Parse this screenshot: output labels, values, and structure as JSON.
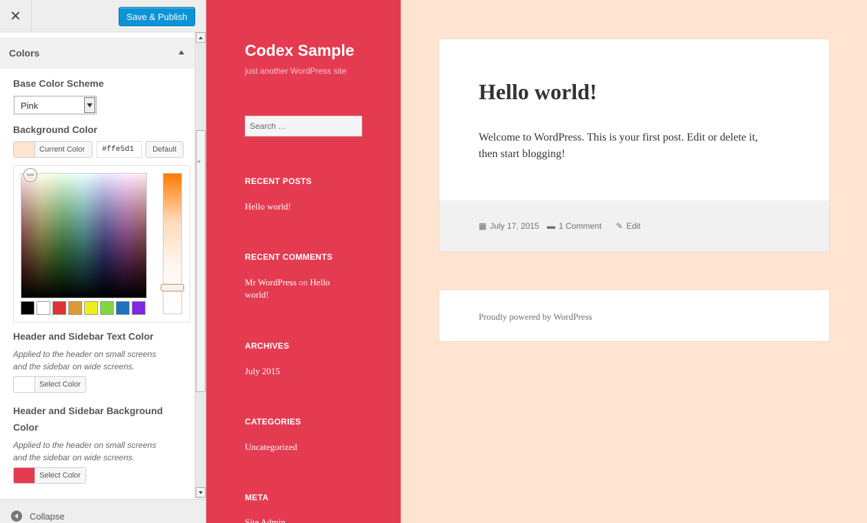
{
  "customizer": {
    "close_label": "✕",
    "publish_label": "Save & Publish",
    "section_title": "Colors",
    "base_scheme": {
      "label": "Base Color Scheme",
      "value": "Pink"
    },
    "background_color": {
      "label": "Background Color",
      "current_label": "Current Color",
      "swatch_color": "#ffe5d1",
      "hex_value": "#ffe5d1",
      "default_label": "Default"
    },
    "palette": [
      "#000000",
      "#ffffff",
      "#dd3333",
      "#dd9933",
      "#eeee22",
      "#81d742",
      "#1e73be",
      "#8224e3"
    ],
    "header_text_color": {
      "label": "Header and Sidebar Text Color",
      "desc_line1": "Applied to the header on small screens",
      "desc_line2": "and the sidebar on wide screens.",
      "button_label": "Select Color",
      "swatch_color": "#ffffff"
    },
    "header_bg_color": {
      "label_line1": "Header and Sidebar Background",
      "label_line2": "Color",
      "desc_line1": "Applied to the header on small screens",
      "desc_line2": "and the sidebar on wide screens.",
      "button_label": "Select Color",
      "swatch_color": "#e53b51"
    },
    "collapse_label": "Collapse"
  },
  "sidebar": {
    "site_title": "Codex Sample",
    "tagline": "just another WordPress site",
    "search_placeholder": "Search …",
    "recent_posts": {
      "title": "RECENT POSTS",
      "items": [
        "Hello world!"
      ]
    },
    "recent_comments": {
      "title": "RECENT COMMENTS",
      "author": "Mr WordPress",
      "connector": "on",
      "post_line1": "Hello",
      "post_line2": "world!"
    },
    "archives": {
      "title": "ARCHIVES",
      "items": [
        "July 2015"
      ]
    },
    "categories": {
      "title": "CATEGORIES",
      "items": [
        "Uncategorized"
      ]
    },
    "meta": {
      "title": "META",
      "items": [
        "Site Admin"
      ]
    },
    "bg_color": "#e53b51"
  },
  "post": {
    "title": "Hello world!",
    "body_line1": "Welcome to WordPress. This is your first post. Edit or delete it,",
    "body_line2": "then start blogging!",
    "date": "July 17, 2015",
    "comments": "1 Comment",
    "edit": "Edit"
  },
  "footer": {
    "text": "Proudly powered by WordPress"
  },
  "page_bg_color": "#ffe5d1"
}
